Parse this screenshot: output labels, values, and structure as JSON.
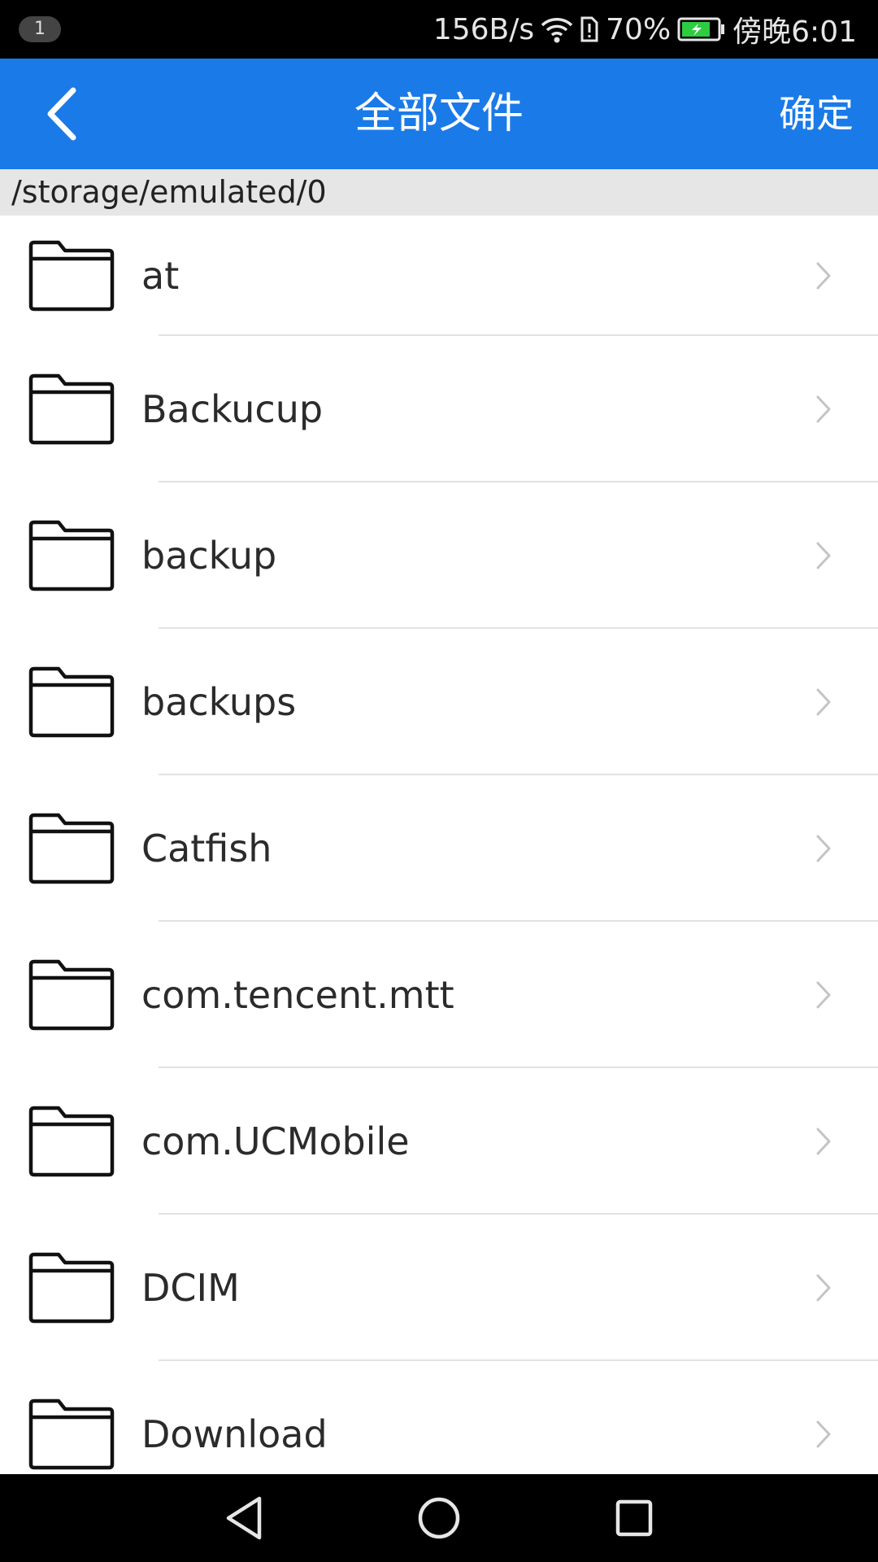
{
  "status_bar": {
    "notification_count": "1",
    "network_speed": "156B/s",
    "battery_percent": "70%",
    "time": "傍晚6:01",
    "icons": [
      "wifi-icon",
      "sim-alert-icon",
      "battery-charging-icon"
    ]
  },
  "header": {
    "title": "全部文件",
    "confirm_label": "确定",
    "back_icon": "chevron-left-icon"
  },
  "path": "/storage/emulated/0",
  "files": [
    {
      "name": "at"
    },
    {
      "name": "Backucup"
    },
    {
      "name": "backup"
    },
    {
      "name": "backups"
    },
    {
      "name": "Catfish"
    },
    {
      "name": "com.tencent.mtt"
    },
    {
      "name": "com.UCMobile"
    },
    {
      "name": "DCIM"
    },
    {
      "name": "Download"
    }
  ],
  "nav_bar": {
    "icons": [
      "back-triangle-icon",
      "home-circle-icon",
      "recents-square-icon"
    ]
  },
  "colors": {
    "header_bg": "#1a7ae8",
    "path_bar_bg": "#e6e6e6",
    "battery_fill": "#2ecc40"
  }
}
